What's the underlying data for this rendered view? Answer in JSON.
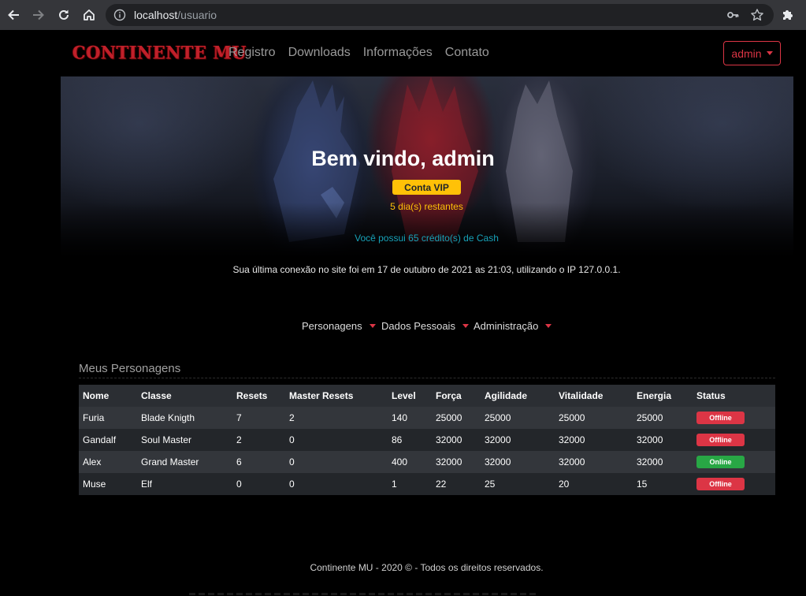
{
  "browser": {
    "url_host": "localhost",
    "url_path": "/usuario"
  },
  "site": {
    "brand": "CONTINENTE MU",
    "nav": [
      {
        "label": "Registro"
      },
      {
        "label": "Downloads"
      },
      {
        "label": "Informações"
      },
      {
        "label": "Contato"
      }
    ],
    "user_menu": "admin"
  },
  "welcome": {
    "title": "Bem vindo, admin",
    "vip_badge": "Conta VIP",
    "days_left": "5 dia(s) restantes",
    "credits": "Você possui 65 crédito(s) de Cash",
    "last_login": "Sua última conexão no site foi em 17 de outubro de 2021 as 21:03, utilizando o IP 127.0.0.1."
  },
  "menu": [
    {
      "label": "Personagens"
    },
    {
      "label": "Dados Pessoais"
    },
    {
      "label": "Administração"
    }
  ],
  "characters": {
    "title": "Meus Personagens",
    "columns": [
      "Nome",
      "Classe",
      "Resets",
      "Master Resets",
      "Level",
      "Força",
      "Agilidade",
      "Vitalidade",
      "Energia",
      "Status"
    ],
    "rows": [
      {
        "nome": "Furia",
        "classe": "Blade Knigth",
        "resets": "7",
        "master": "2",
        "level": "140",
        "forca": "25000",
        "agilidade": "25000",
        "vitalidade": "25000",
        "energia": "25000",
        "status": "Offline"
      },
      {
        "nome": "Gandalf",
        "classe": "Soul Master",
        "resets": "2",
        "master": "0",
        "level": "86",
        "forca": "32000",
        "agilidade": "32000",
        "vitalidade": "32000",
        "energia": "32000",
        "status": "Offline"
      },
      {
        "nome": "Alex",
        "classe": "Grand Master",
        "resets": "6",
        "master": "0",
        "level": "400",
        "forca": "32000",
        "agilidade": "32000",
        "vitalidade": "32000",
        "energia": "32000",
        "status": "Online"
      },
      {
        "nome": "Muse",
        "classe": "Elf",
        "resets": "0",
        "master": "0",
        "level": "1",
        "forca": "22",
        "agilidade": "25",
        "vitalidade": "20",
        "energia": "15",
        "status": "Offline"
      }
    ]
  },
  "footer": "Continente MU - 2020 © - Todos os direitos reservados.",
  "colors": {
    "brand": "#c0202a",
    "danger": "#dc3545",
    "warning": "#ffc107",
    "info": "#17a2b8",
    "success": "#28a745"
  }
}
